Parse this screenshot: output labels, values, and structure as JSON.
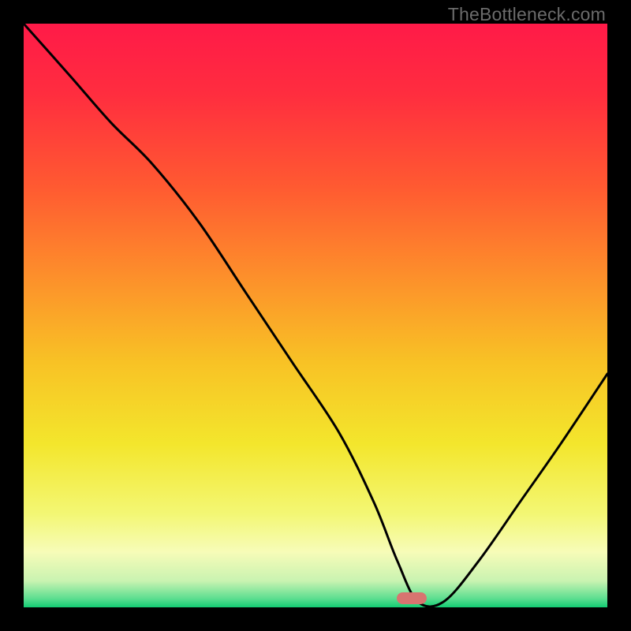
{
  "watermark": "TheBottleneck.com",
  "colors": {
    "frame": "#000000",
    "curve_stroke": "#000000",
    "pill": "#d87470",
    "gradient_stops": [
      {
        "offset": 0.0,
        "color": "#ff1a48"
      },
      {
        "offset": 0.12,
        "color": "#ff2d3f"
      },
      {
        "offset": 0.28,
        "color": "#ff5a31"
      },
      {
        "offset": 0.43,
        "color": "#fd8e2b"
      },
      {
        "offset": 0.58,
        "color": "#f8c225"
      },
      {
        "offset": 0.72,
        "color": "#f3e62c"
      },
      {
        "offset": 0.84,
        "color": "#f3f774"
      },
      {
        "offset": 0.905,
        "color": "#f7fcb8"
      },
      {
        "offset": 0.955,
        "color": "#c9f3b1"
      },
      {
        "offset": 0.985,
        "color": "#5cde90"
      },
      {
        "offset": 1.0,
        "color": "#12cc73"
      }
    ]
  },
  "pill": {
    "x_frac": 0.665,
    "y_frac": 0.99
  },
  "chart_data": {
    "type": "line",
    "title": "",
    "xlabel": "",
    "ylabel": "",
    "xlim": [
      0,
      100
    ],
    "ylim": [
      0,
      100
    ],
    "series": [
      {
        "name": "curve",
        "x": [
          0,
          8,
          15,
          22,
          30,
          38,
          46,
          54,
          60,
          64,
          67.5,
          72,
          78,
          85,
          92,
          100
        ],
        "y": [
          100,
          91,
          83,
          76,
          66,
          54,
          42,
          30,
          18,
          8,
          1,
          1,
          8,
          18,
          28,
          40
        ]
      }
    ],
    "notes": "V-shaped minimum-seeking curve over vertical rainbow gradient (red→green). Minimum sits near x≈68, marked by a red pill on the baseline. y represents some performance/mismatch metric where 0 (bottom, green) is optimal and 100 (top, red) is worst."
  }
}
